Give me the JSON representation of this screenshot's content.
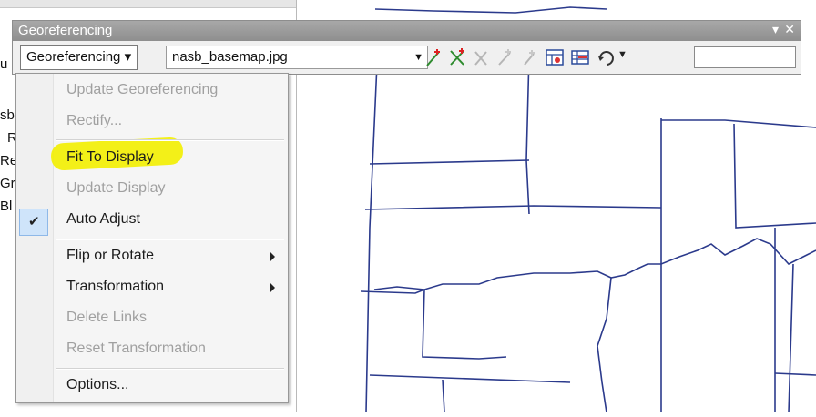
{
  "toolbar": {
    "title": "Georeferencing",
    "menu_button": "Georeferencing ▾",
    "layer": "nasb_basemap.jpg",
    "icons": [
      "add-control-points-icon",
      "auto-registration-icon",
      "select-link-icon",
      "zoom-to-selected-link-icon",
      "delete-link-icon",
      "view-link-table-icon",
      "raster-table-icon",
      "rotate-icon"
    ]
  },
  "toc": {
    "fragments": [
      "u",
      "sb",
      "R",
      "Re",
      "Gr",
      "Bl"
    ]
  },
  "menu": {
    "items": [
      {
        "label": "Update Georeferencing",
        "enabled": false
      },
      {
        "label": "Rectify...",
        "enabled": false
      },
      {
        "label": "Fit To Display",
        "enabled": true,
        "highlighted": true
      },
      {
        "label": "Update Display",
        "enabled": false
      },
      {
        "label": "Auto Adjust",
        "enabled": true,
        "checked": true
      },
      {
        "label": "Flip or Rotate",
        "enabled": true,
        "submenu": true
      },
      {
        "label": "Transformation",
        "enabled": true,
        "submenu": true
      },
      {
        "label": "Delete Links",
        "enabled": false
      },
      {
        "label": "Reset Transformation",
        "enabled": false
      },
      {
        "label": "Options...",
        "enabled": true
      }
    ],
    "check_mark": "✔"
  },
  "colors": {
    "map_lines": "#2b3a8c",
    "highlight": "#f3f000",
    "title_bar": "#999999"
  }
}
